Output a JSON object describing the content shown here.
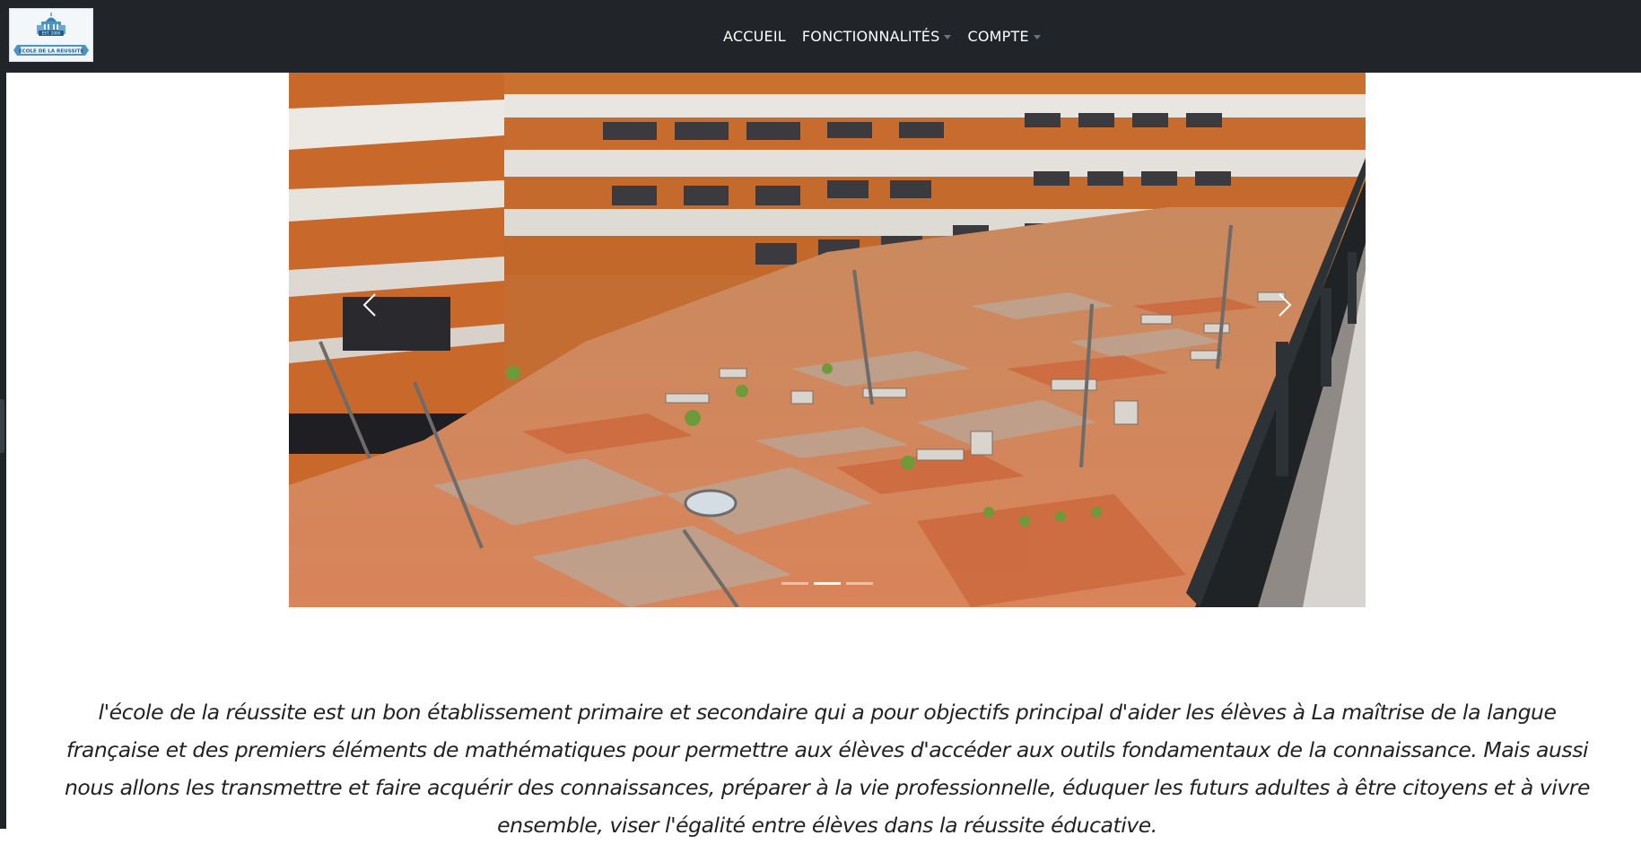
{
  "navbar": {
    "logo": {
      "alt": "ECOLE DE LA REUSSITE",
      "ribbon_text": "ECOLE DE LA REUSSITE",
      "badge_text": "EST. 2000"
    },
    "links": [
      {
        "label": "ACCUEIL",
        "has_dropdown": false
      },
      {
        "label": "FONCTIONNALITÉS",
        "has_dropdown": true
      },
      {
        "label": "COMPTE",
        "has_dropdown": true
      }
    ]
  },
  "carousel": {
    "slide_count": 3,
    "active_index": 1,
    "image_alt": "Cour intérieure de l'école"
  },
  "intro": {
    "text": "l'école de la réussite est un bon établissement primaire et secondaire qui a pour objectifs principal d'aider les élèves à La maîtrise de la langue française et des premiers éléments de mathématiques pour permettre aux élèves d'accéder aux outils fondamentaux de la connaissance. Mais aussi nous allons les transmettre et faire acquérir des connaissances, préparer à la vie professionnelle, éduquer les futurs adultes à être citoyens et à vivre ensemble, viser l'égalité entre élèves dans la réussite éducative."
  },
  "colors": {
    "navbar_bg": "#212529",
    "facade_orange": "#c46d33",
    "ground_orange": "#d8875a",
    "text": "#222222"
  }
}
